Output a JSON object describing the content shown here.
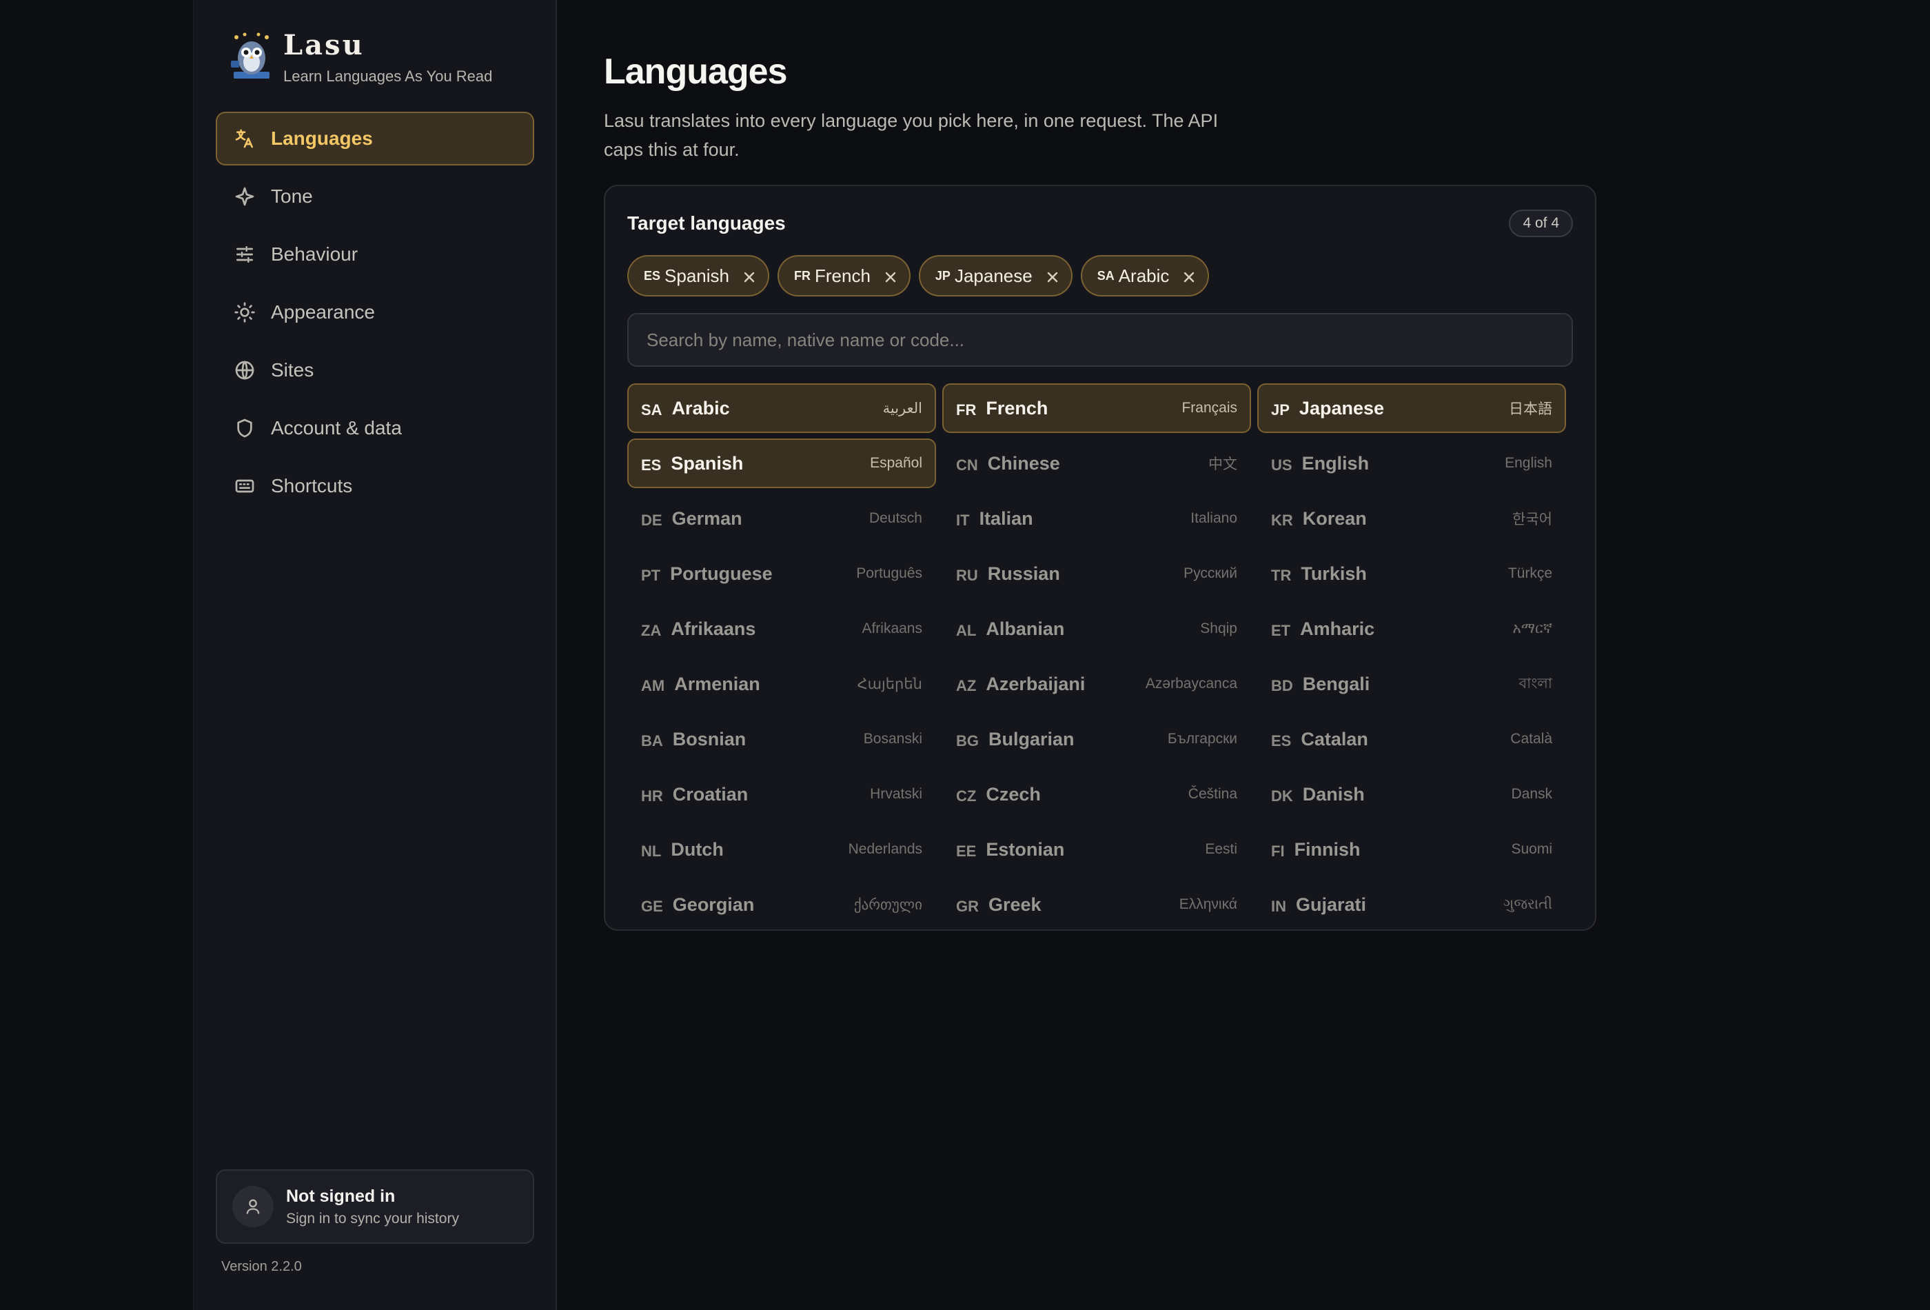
{
  "brand": {
    "name": "Lasu",
    "tagline": "Learn Languages As You Read"
  },
  "nav": [
    {
      "label": "Languages",
      "icon": "translate-icon",
      "active": true
    },
    {
      "label": "Tone",
      "icon": "sparkle-icon",
      "active": false
    },
    {
      "label": "Behaviour",
      "icon": "sliders-icon",
      "active": false
    },
    {
      "label": "Appearance",
      "icon": "sun-icon",
      "active": false
    },
    {
      "label": "Sites",
      "icon": "globe-icon",
      "active": false
    },
    {
      "label": "Account & data",
      "icon": "shield-icon",
      "active": false
    },
    {
      "label": "Shortcuts",
      "icon": "keyboard-icon",
      "active": false
    }
  ],
  "account": {
    "title": "Not signed in",
    "subtitle": "Sign in to sync your history"
  },
  "version": "Version 2.2.0",
  "page": {
    "title": "Languages",
    "description": "Lasu translates into every language you pick here, in one request. The API caps this at four."
  },
  "panel": {
    "title": "Target languages",
    "count": "4 of 4",
    "chips": [
      {
        "code": "ES",
        "name": "Spanish"
      },
      {
        "code": "FR",
        "name": "French"
      },
      {
        "code": "JP",
        "name": "Japanese"
      },
      {
        "code": "SA",
        "name": "Arabic"
      }
    ],
    "search_placeholder": "Search by name, native name or code...",
    "languages": [
      {
        "code": "SA",
        "name": "Arabic",
        "native": "العربية",
        "selected": true
      },
      {
        "code": "FR",
        "name": "French",
        "native": "Français",
        "selected": true
      },
      {
        "code": "JP",
        "name": "Japanese",
        "native": "日本語",
        "selected": true
      },
      {
        "code": "ES",
        "name": "Spanish",
        "native": "Español",
        "selected": true
      },
      {
        "code": "CN",
        "name": "Chinese",
        "native": "中文",
        "selected": false
      },
      {
        "code": "US",
        "name": "English",
        "native": "English",
        "selected": false
      },
      {
        "code": "DE",
        "name": "German",
        "native": "Deutsch",
        "selected": false
      },
      {
        "code": "IT",
        "name": "Italian",
        "native": "Italiano",
        "selected": false
      },
      {
        "code": "KR",
        "name": "Korean",
        "native": "한국어",
        "selected": false
      },
      {
        "code": "PT",
        "name": "Portuguese",
        "native": "Português",
        "selected": false
      },
      {
        "code": "RU",
        "name": "Russian",
        "native": "Русский",
        "selected": false
      },
      {
        "code": "TR",
        "name": "Turkish",
        "native": "Türkçe",
        "selected": false
      },
      {
        "code": "ZA",
        "name": "Afrikaans",
        "native": "Afrikaans",
        "selected": false
      },
      {
        "code": "AL",
        "name": "Albanian",
        "native": "Shqip",
        "selected": false
      },
      {
        "code": "ET",
        "name": "Amharic",
        "native": "አማርኛ",
        "selected": false
      },
      {
        "code": "AM",
        "name": "Armenian",
        "native": "Հայերեն",
        "selected": false
      },
      {
        "code": "AZ",
        "name": "Azerbaijani",
        "native": "Azərbaycanca",
        "selected": false
      },
      {
        "code": "BD",
        "name": "Bengali",
        "native": "বাংলা",
        "selected": false
      },
      {
        "code": "BA",
        "name": "Bosnian",
        "native": "Bosanski",
        "selected": false
      },
      {
        "code": "BG",
        "name": "Bulgarian",
        "native": "Български",
        "selected": false
      },
      {
        "code": "ES",
        "name": "Catalan",
        "native": "Català",
        "selected": false
      },
      {
        "code": "HR",
        "name": "Croatian",
        "native": "Hrvatski",
        "selected": false
      },
      {
        "code": "CZ",
        "name": "Czech",
        "native": "Čeština",
        "selected": false
      },
      {
        "code": "DK",
        "name": "Danish",
        "native": "Dansk",
        "selected": false
      },
      {
        "code": "NL",
        "name": "Dutch",
        "native": "Nederlands",
        "selected": false
      },
      {
        "code": "EE",
        "name": "Estonian",
        "native": "Eesti",
        "selected": false
      },
      {
        "code": "FI",
        "name": "Finnish",
        "native": "Suomi",
        "selected": false
      },
      {
        "code": "GE",
        "name": "Georgian",
        "native": "ქართული",
        "selected": false
      },
      {
        "code": "GR",
        "name": "Greek",
        "native": "Ελληνικά",
        "selected": false
      },
      {
        "code": "IN",
        "name": "Gujarati",
        "native": "ગુજરાતી",
        "selected": false
      }
    ]
  },
  "colors": {
    "background": "#0d0e12",
    "sidebar": "#15161c",
    "accent": "#f3c766",
    "selected_fill": "#3a3022",
    "selected_border": "#7a6131"
  }
}
